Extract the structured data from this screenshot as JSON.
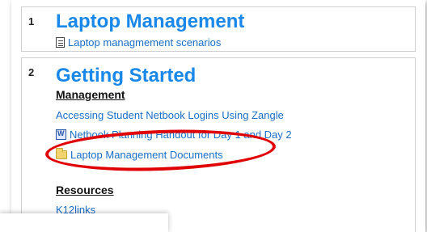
{
  "section1": {
    "number": "1",
    "title": "Laptop Management",
    "items": [
      {
        "label": "Laptop managmement scenarios",
        "icon": "document-icon"
      }
    ]
  },
  "section2": {
    "number": "2",
    "title": "Getting Started",
    "management_heading": "Management",
    "management_items": [
      {
        "label": "Accessing Student Netbook Logins Using Zangle"
      },
      {
        "label": "Netbook Planning Handout for Day 1 and Day 2",
        "icon": "word-document-icon"
      },
      {
        "label": "Laptop Management Documents",
        "icon": "folder-icon"
      }
    ],
    "resources_heading": "Resources",
    "resources_items": [
      {
        "label": "K12links"
      }
    ]
  },
  "colors": {
    "title_blue": "#1a88ea",
    "link_blue": "#1a6ec6",
    "highlight_red": "#e00000"
  }
}
